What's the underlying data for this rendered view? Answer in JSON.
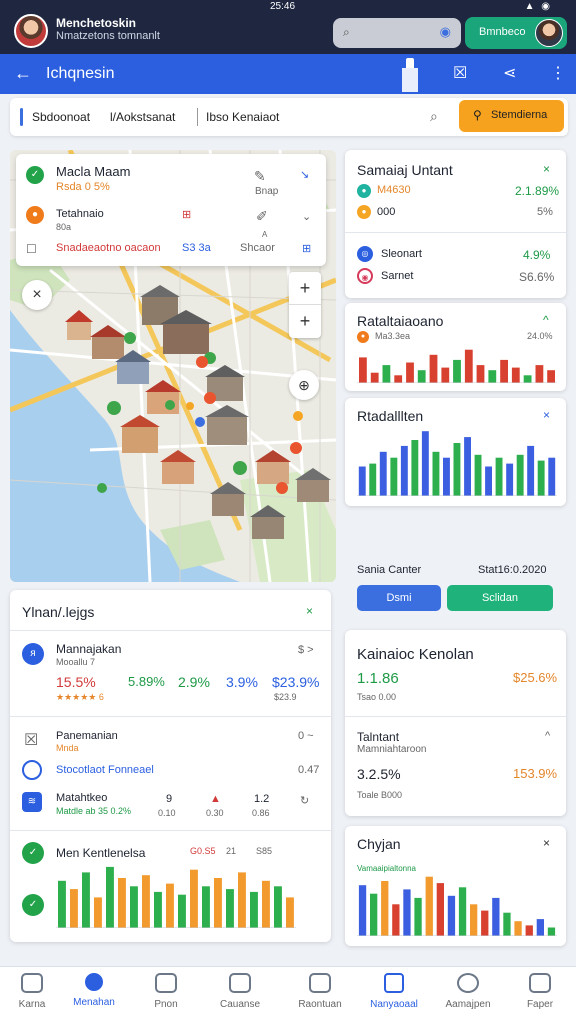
{
  "status": {
    "time": "25:46",
    "signal": "▲ ◉"
  },
  "header": {
    "user_name": "Menchetoskin",
    "user_sub": "Nmatzetons tomnanlt",
    "action_label": "Bmnbeco"
  },
  "appbar": {
    "title": "Ichqnesin"
  },
  "filters": {
    "items": [
      "Sbdoonoat",
      "l/Aokstsanat",
      "Ibso Kenaiaot"
    ],
    "action_label": "Stemdierna"
  },
  "map_card": {
    "row1_title": "Macla Maam",
    "row1_sub": "Rsda 0 5%",
    "row1_icon": "Bnap",
    "row2_title": "Tetahnaio",
    "row2_sub": "80a",
    "row3_left": "Snadaeaotno oacaon",
    "row3_mid": "S3 3a",
    "row3_right": "Shcaor",
    "row3_a": "A"
  },
  "card_stats": {
    "title": "Samaiaj Untant",
    "row1_label": "M4630",
    "row1_value": "2.1.89%",
    "row2_label": "000",
    "row2_value": "5%",
    "row3_label": "Sleonart",
    "row3_value": "4.9%",
    "row4_label": "Sarnet",
    "row4_value": "S6.6%"
  },
  "card_bar1": {
    "title": "Rataltaiaoano",
    "sub": "Ma3.3ea",
    "value": "24.0%"
  },
  "card_bar2": {
    "title": "Rtadalllten"
  },
  "card_center": {
    "label": "Sania Canter",
    "value": "Stat16:0.2020",
    "btn1": "Dsmi",
    "btn2": "Sclidan"
  },
  "list_panel": {
    "title": "Ylnan/.lejgs",
    "item1_title": "Mannajakan",
    "item1_sub": "Mooallu 7",
    "item1_right": "$ >",
    "item1_vals": [
      "15.5%",
      "5.89%",
      "2.9%",
      "3.9%",
      "$23.9%"
    ],
    "item1_stars": "★★★★★ 6",
    "item1_tail": "$23.9",
    "item2_title": "Panemanian",
    "item2_sub": "Mnda",
    "item2_right": "0 ~",
    "item3_title": "Stocotlaot Fonneael",
    "item3_right": "0.47",
    "item4_title": "Matahtkeo",
    "item4_sub": "Matdle ab 35 0.2%",
    "item4_v1": "9",
    "item4_v2": "1.2",
    "item4_s1": "0.10",
    "item4_s2": "0.30",
    "item4_s3": "0.86",
    "chart_title": "Men Kentlenelsa",
    "chart_v1": "G0.S5",
    "chart_v2": "21",
    "chart_v3": "S85"
  },
  "card_kpi": {
    "title": "Kainaioc Kenolan",
    "v1": "1.1.86",
    "v1_right": "$25.6%",
    "v1_sub": "Tsao 0.00",
    "sub_title": "Talntant",
    "sub_label": "Mamniahtaroon",
    "v2": "3.2.5%",
    "v2_right": "153.9%",
    "v2_sub": "Toale B000"
  },
  "card_bar3": {
    "title": "Chyjan",
    "legend": "Vamaaipialtonna"
  },
  "nav": [
    "Karna",
    "Menahan",
    "Pnon",
    "Cauanse",
    "Raontuan",
    "Nanyaoaal",
    "Aamajpen",
    "Faper"
  ],
  "colors": {
    "blue": "#3b5fe0",
    "green": "#2eaf4e",
    "orange": "#f29a2e",
    "red": "#d8412f"
  },
  "chart_data": [
    {
      "type": "bar",
      "title": "Rataltaiaoano",
      "series": [
        {
          "values": [
            20,
            8,
            14,
            6,
            16,
            10,
            22,
            12,
            18,
            26,
            14,
            10,
            18,
            12,
            6,
            14,
            10
          ]
        }
      ]
    },
    {
      "type": "bar",
      "title": "Rtadalllten",
      "series": [
        {
          "values": [
            20,
            22,
            30,
            26,
            34,
            38,
            44,
            30,
            26,
            36,
            40,
            28,
            20,
            26,
            22,
            28,
            34,
            24,
            26
          ]
        }
      ]
    },
    {
      "type": "bar",
      "title": "Men Kentlenelsa",
      "series": [
        {
          "values": [
            34,
            28,
            40,
            22,
            44,
            36,
            30,
            38,
            26,
            32,
            24,
            42,
            30,
            36,
            28,
            40,
            26,
            34,
            30,
            22
          ]
        }
      ]
    },
    {
      "type": "bar",
      "title": "Chyjan",
      "series": [
        {
          "values": [
            48,
            40,
            52,
            30,
            44,
            36,
            56,
            50,
            38,
            46,
            30,
            24,
            36,
            22,
            14,
            10,
            16,
            8
          ]
        }
      ]
    }
  ]
}
